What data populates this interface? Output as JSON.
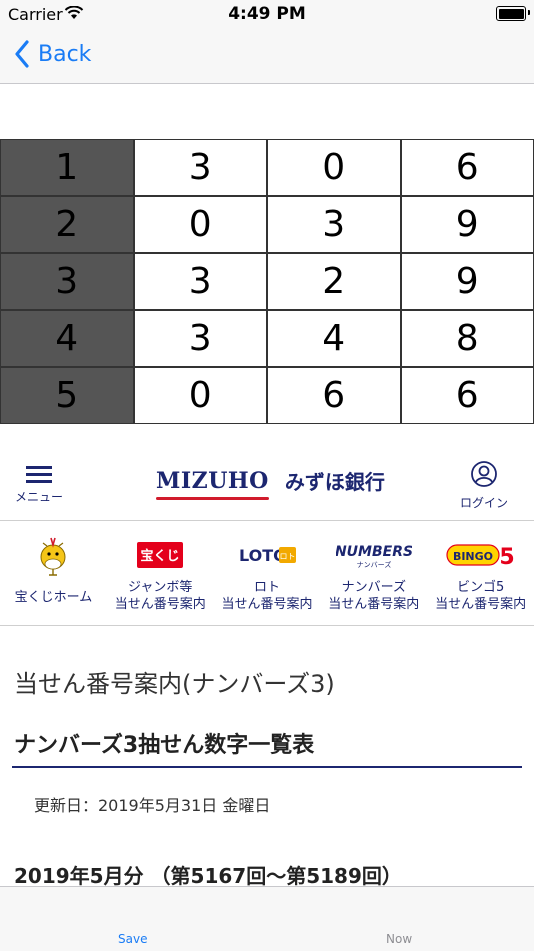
{
  "status_bar": {
    "carrier": "Carrier",
    "time": "4:49 PM"
  },
  "nav": {
    "back_label": "Back"
  },
  "grid": {
    "rows": [
      {
        "index": "1",
        "digits": [
          "3",
          "0",
          "6"
        ]
      },
      {
        "index": "2",
        "digits": [
          "0",
          "3",
          "9"
        ]
      },
      {
        "index": "3",
        "digits": [
          "3",
          "2",
          "9"
        ]
      },
      {
        "index": "4",
        "digits": [
          "3",
          "4",
          "8"
        ]
      },
      {
        "index": "5",
        "digits": [
          "0",
          "6",
          "6"
        ]
      }
    ]
  },
  "web_header": {
    "menu_label": "メニュー",
    "logo_en": "MIZUHO",
    "logo_jp": "みずほ銀行",
    "login_label": "ログイン"
  },
  "lottery_nav": {
    "items": [
      {
        "label1": "宝くじホーム",
        "label2": ""
      },
      {
        "label1": "ジャンボ等",
        "label2": "当せん番号案内",
        "logo_text": "宝くじ"
      },
      {
        "label1": "ロト",
        "label2": "当せん番号案内",
        "logo_text": "LOTO",
        "logo_sub": "ロト"
      },
      {
        "label1": "ナンバーズ",
        "label2": "当せん番号案内",
        "logo_text": "NUMBERS",
        "logo_sub": "ナンバーズ"
      },
      {
        "label1": "ビンゴ5",
        "label2": "当せん番号案内",
        "logo_text": "BINGO",
        "logo_num": "5"
      }
    ]
  },
  "content": {
    "page_title": "当せん番号案内(ナンバーズ3)",
    "section_title": "ナンバーズ3抽せん数字一覧表",
    "updated": "更新日：2019年5月31日 金曜日",
    "month_title": "2019年5月分 （第5167回〜第5189回）"
  },
  "tab_bar": {
    "save_label": "Save",
    "now_label": "Now"
  },
  "colors": {
    "accent": "#1a7cf5",
    "brand_navy": "#1c2670",
    "brand_red": "#d11b2c",
    "grid_head": "#555555"
  }
}
